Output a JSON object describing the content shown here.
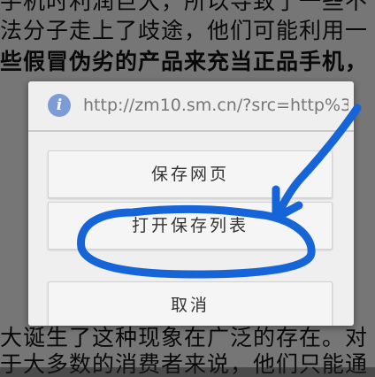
{
  "background": {
    "lines": [
      "手机时利润巨大，所以导致了一些不",
      "法分子走上了歧途，他们可能利用一",
      "些假冒伪劣的产品来充当正品手机，",
      "",
      "大诞生了这种现象在广泛的存在。对",
      "于大多数的消费者来说，他们只能通"
    ]
  },
  "dialog": {
    "icon": "info-icon",
    "title": "http://zm10.sm.cn/?src=http%3...",
    "buttons": {
      "save": "保存网页",
      "open_list": "打开保存列表",
      "cancel": "取消"
    }
  },
  "colors": {
    "annotation_stroke": "#1565d8",
    "info_icon": "#7d9bd4"
  }
}
